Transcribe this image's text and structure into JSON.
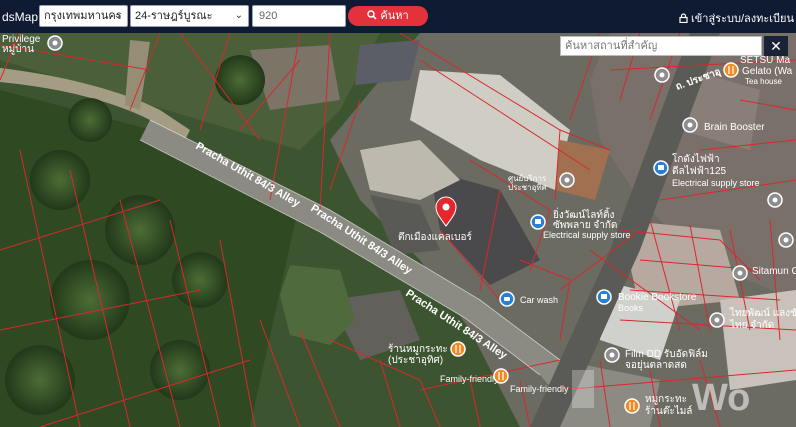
{
  "header": {
    "brand": "dsMaps",
    "province": "กรุงเทพมหานคร",
    "district": "24-ราษฎร์บูรณะ",
    "number": "920",
    "search_label": "ค้นหา",
    "login_label": "เข้าสู่ระบบ/ลงทะเบียน"
  },
  "map": {
    "search_placeholder": "ค้นหาสถานที่สำคัญ",
    "close_label": "✕",
    "roads": [
      {
        "label": "Pracha Uthit 84/3 Alley"
      },
      {
        "label": "Pracha Uthit 84/3 Alley"
      },
      {
        "label": "Pracha Uthit 84/3 Alley"
      },
      {
        "label": "ถ. ประชาอุ"
      }
    ],
    "places": [
      {
        "label": "Privilege",
        "icon": "location-icon"
      },
      {
        "label": "หมู่บ้าน",
        "icon": "location-icon"
      },
      {
        "label": "SETSU Ma",
        "icon": "location-icon"
      },
      {
        "label": "Gelato (Wa",
        "icon": "food-icon"
      },
      {
        "label": "Tea house",
        "icon": "food-icon"
      },
      {
        "label": "Brain Booster",
        "icon": "location-icon"
      },
      {
        "label": "โกดังไฟฟ้า",
        "icon": "shop-icon"
      },
      {
        "label": "ดีลไฟฟ้า125",
        "icon": "shop-icon"
      },
      {
        "label": "Electrical supply store",
        "icon": "shop-icon"
      },
      {
        "label": "ศูนย์บริการ",
        "icon": "location-icon"
      },
      {
        "label": "ประชาอุทิศ",
        "icon": "location-icon"
      },
      {
        "label": "ยิ่งวัฒน์ไลท์ติ้ง",
        "icon": "shop-icon"
      },
      {
        "label": "ซัพพลาย จำกัด",
        "icon": "shop-icon"
      },
      {
        "label": "Electrical supply store",
        "icon": "shop-icon"
      },
      {
        "label": "ตึกเมืองแคลเบอร์",
        "icon": "pin-icon"
      },
      {
        "label": "Car wash",
        "icon": "car-wash-icon"
      },
      {
        "label": "Bookie Bookstore",
        "icon": "shop-icon"
      },
      {
        "label": "Books",
        "icon": "shop-icon"
      },
      {
        "label": "Sitamun Ga",
        "icon": "location-icon"
      },
      {
        "label": "ไทยพัฒน์ แลงชัย",
        "icon": "location-icon"
      },
      {
        "label": "ไทย จำกัด",
        "icon": "location-icon"
      },
      {
        "label": "Film DD รับอัดฟิล์ม",
        "icon": "location-icon"
      },
      {
        "label": "จอยุ่นตลาดสด",
        "icon": "location-icon"
      },
      {
        "label": "ร้านหมูกระทะ",
        "icon": "food-icon"
      },
      {
        "label": "(ประชาอุทิศ)",
        "icon": "food-icon"
      },
      {
        "label": "Family-friendly",
        "icon": "food-icon"
      },
      {
        "label": "Family-friendly",
        "icon": "food-icon"
      },
      {
        "label": "หมูกระทะ",
        "icon": "food-icon"
      },
      {
        "label": "ร้านต๊ะไมล์",
        "icon": "food-icon"
      }
    ],
    "watermark": "Wo",
    "colors": {
      "boundary": "#d8282e",
      "pin": "#e5262d",
      "header_bg": "#0f1b33",
      "search_button": "#e4323d"
    }
  }
}
